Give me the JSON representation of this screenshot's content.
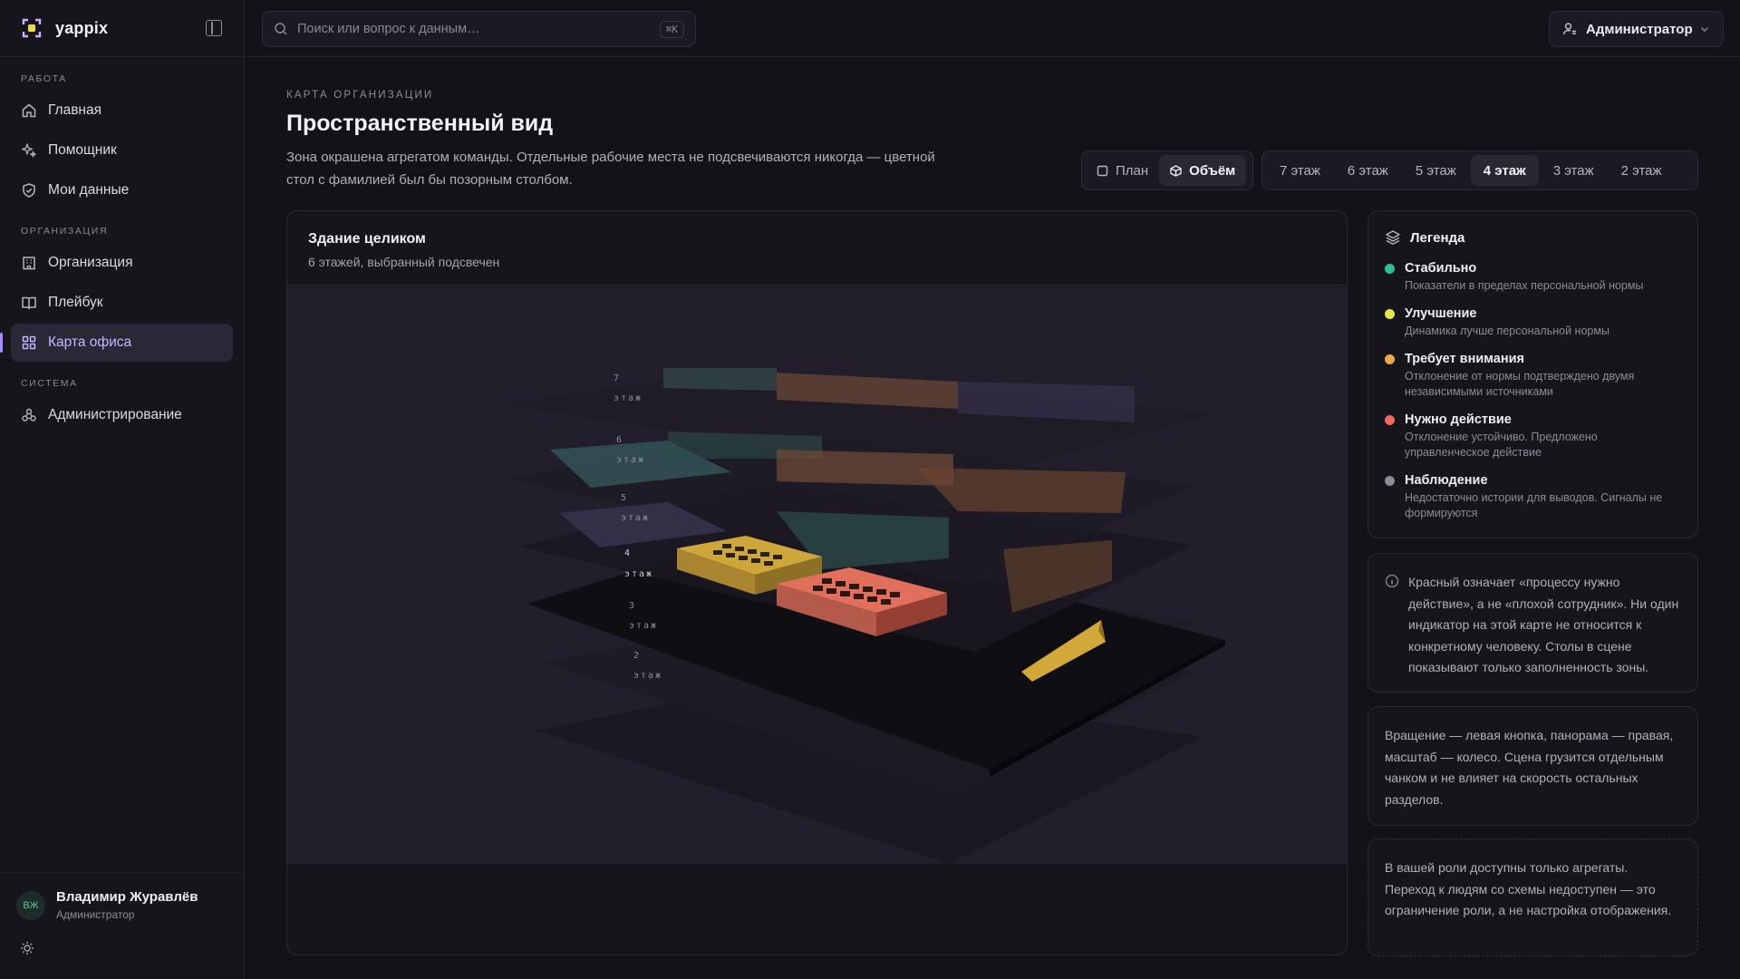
{
  "app": {
    "name": "yappix"
  },
  "sidebar": {
    "sections": [
      {
        "title": "РАБОТА",
        "items": [
          {
            "label": "Главная",
            "icon": "home-icon"
          },
          {
            "label": "Помощник",
            "icon": "sparkle-icon"
          },
          {
            "label": "Мои данные",
            "icon": "shield-icon"
          }
        ]
      },
      {
        "title": "ОРГАНИЗАЦИЯ",
        "items": [
          {
            "label": "Организация",
            "icon": "building-icon"
          },
          {
            "label": "Плейбук",
            "icon": "book-icon"
          },
          {
            "label": "Карта офиса",
            "icon": "grid-icon",
            "active": true
          }
        ]
      },
      {
        "title": "СИСТЕМА",
        "items": [
          {
            "label": "Администрирование",
            "icon": "admin-icon"
          }
        ]
      }
    ],
    "user": {
      "initials": "ВЖ",
      "name": "Владимир Журавлёв",
      "role": "Администратор"
    }
  },
  "topbar": {
    "search_placeholder": "Поиск или вопрос к данным…",
    "search_shortcut": "⌘K",
    "role_label": "Администратор"
  },
  "page": {
    "eyebrow": "КАРТА ОРГАНИЗАЦИИ",
    "title": "Пространственный вид",
    "description": "Зона окрашена агрегатом команды. Отдельные рабочие места не подсвечиваются никогда — цветной стол с фамилией был бы позорным столбом.",
    "view_modes": [
      {
        "label": "План",
        "active": false
      },
      {
        "label": "Объём",
        "active": true
      }
    ],
    "floors": [
      {
        "label": "7 этаж",
        "active": false
      },
      {
        "label": "6 этаж",
        "active": false
      },
      {
        "label": "5 этаж",
        "active": false
      },
      {
        "label": "4 этаж",
        "active": true
      },
      {
        "label": "3 этаж",
        "active": false
      },
      {
        "label": "2 этаж",
        "active": false
      }
    ]
  },
  "scene_panel": {
    "title": "Здание целиком",
    "subtitle": "6 этажей, выбранный подсвечен",
    "floor_labels": [
      {
        "num": "7",
        "word": "этаж"
      },
      {
        "num": "6",
        "word": "этаж"
      },
      {
        "num": "5",
        "word": "этаж"
      },
      {
        "num": "4",
        "word": "этаж"
      },
      {
        "num": "3",
        "word": "этаж"
      },
      {
        "num": "2",
        "word": "этаж"
      }
    ]
  },
  "legend": {
    "title": "Легенда",
    "items": [
      {
        "title": "Стабильно",
        "desc": "Показатели в пределах персональной нормы",
        "color": "#2fbf8f"
      },
      {
        "title": "Улучшение",
        "desc": "Динамика лучше персональной нормы",
        "color": "#e3e34a"
      },
      {
        "title": "Требует внимания",
        "desc": "Отклонение от нормы подтверждено двумя независимыми источниками",
        "color": "#e8a948"
      },
      {
        "title": "Нужно действие",
        "desc": "Отклонение устойчиво. Предложено управленческое действие",
        "color": "#ef6a5a"
      },
      {
        "title": "Наблюдение",
        "desc": "Недостаточно истории для выводов. Сигналы не формируются",
        "color": "#8e8a98"
      }
    ]
  },
  "info_text": "Красный означает «процессу нужно действие», а не «плохой сотрудник». Ни один индикатор на этой карте не относится к конкретному человеку. Столы в сцене показывают только заполненность зоны.",
  "hint_text": "Вращение — левая кнопка, панорама — правая, масштаб — колесо. Сцена грузится отдельным чанком и не влияет на скорость остальных разделов.",
  "note_text": "В вашей роли доступны только агрегаты. Переход к людям со схемы недоступен — это ограничение роли, а не настройка отображения.",
  "colors": {
    "accent": "#a78bfa",
    "stable": "#2fbf8f",
    "improve": "#e3e34a",
    "attention": "#e8a948",
    "action": "#ef6a5a",
    "observe": "#8e8a98"
  }
}
